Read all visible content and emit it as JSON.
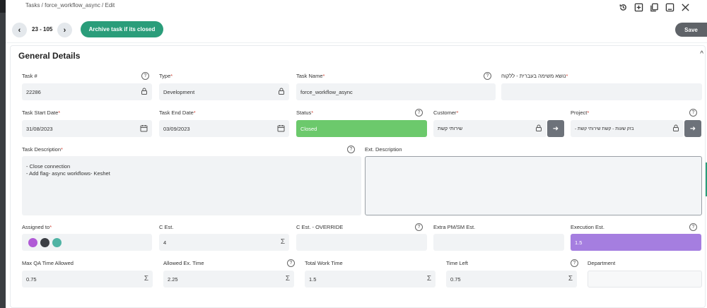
{
  "breadcrumb": "Tasks / force_workflow_async / Edit",
  "window_icons": [
    "history-icon",
    "add-window-icon",
    "copy-icon",
    "minimize-icon",
    "close-icon"
  ],
  "toolbar": {
    "prev_symbol": "‹",
    "next_symbol": "›",
    "counter": "23 - 105",
    "archive_label": "Archive task if its closed",
    "save_label": "Save"
  },
  "section": {
    "title": "General Details",
    "collapse_symbol": "^"
  },
  "help_symbol": "?",
  "sum_symbol": "Σ",
  "fields": {
    "task_no": {
      "label": "Task #",
      "value": "22286"
    },
    "type": {
      "label": "Type",
      "value": "Development"
    },
    "task_name": {
      "label": "Task Name",
      "value": "force_workflow_async"
    },
    "hebrew_subject": {
      "label": "נושא משימה בעברית - ללקוח",
      "value": ""
    },
    "start_date": {
      "label": "Task Start Date",
      "value": "31/08/2023"
    },
    "end_date": {
      "label": "Task End Date",
      "value": "03/09/2023"
    },
    "status": {
      "label": "Status",
      "value": "Closed",
      "color": "#6cc96c"
    },
    "customer": {
      "label": "Customer",
      "value": "שירותי קשת"
    },
    "project": {
      "label": "Project",
      "value": "בזק שעות - קשת שירותי קשת -"
    },
    "description": {
      "label": "Task Description",
      "lines": [
        "- Close connection",
        "- Add flag- async workflows- Keshet"
      ]
    },
    "ext_description": {
      "label": "Ext. Description",
      "value": ""
    },
    "assigned_to": {
      "label": "Assigned to"
    },
    "c_est": {
      "label": "C Est.",
      "value": "4"
    },
    "c_est_override": {
      "label": "C Est. - OVERRIDE",
      "value": ""
    },
    "extra_pm": {
      "label": "Extra PM/SM Est.",
      "value": ""
    },
    "execution_est": {
      "label": "Execution Est.",
      "value": "1.5",
      "color": "#a57ee0"
    },
    "max_qa": {
      "label": "Max QA Time Allowed",
      "value": "0.75"
    },
    "allowed_ex": {
      "label": "Allowed Ex. Time",
      "value": "2.25"
    },
    "total_work": {
      "label": "Total Work Time",
      "value": "1.5"
    },
    "time_left": {
      "label": "Time Left",
      "value": "0.75"
    },
    "department": {
      "label": "Department",
      "value": ""
    }
  },
  "avatars": [
    {
      "name": "avatar-purple",
      "color": "#b05ad6"
    },
    {
      "name": "avatar-dark",
      "color": "#3b3e44"
    },
    {
      "name": "avatar-teal",
      "color": "#4fb3a4"
    }
  ]
}
